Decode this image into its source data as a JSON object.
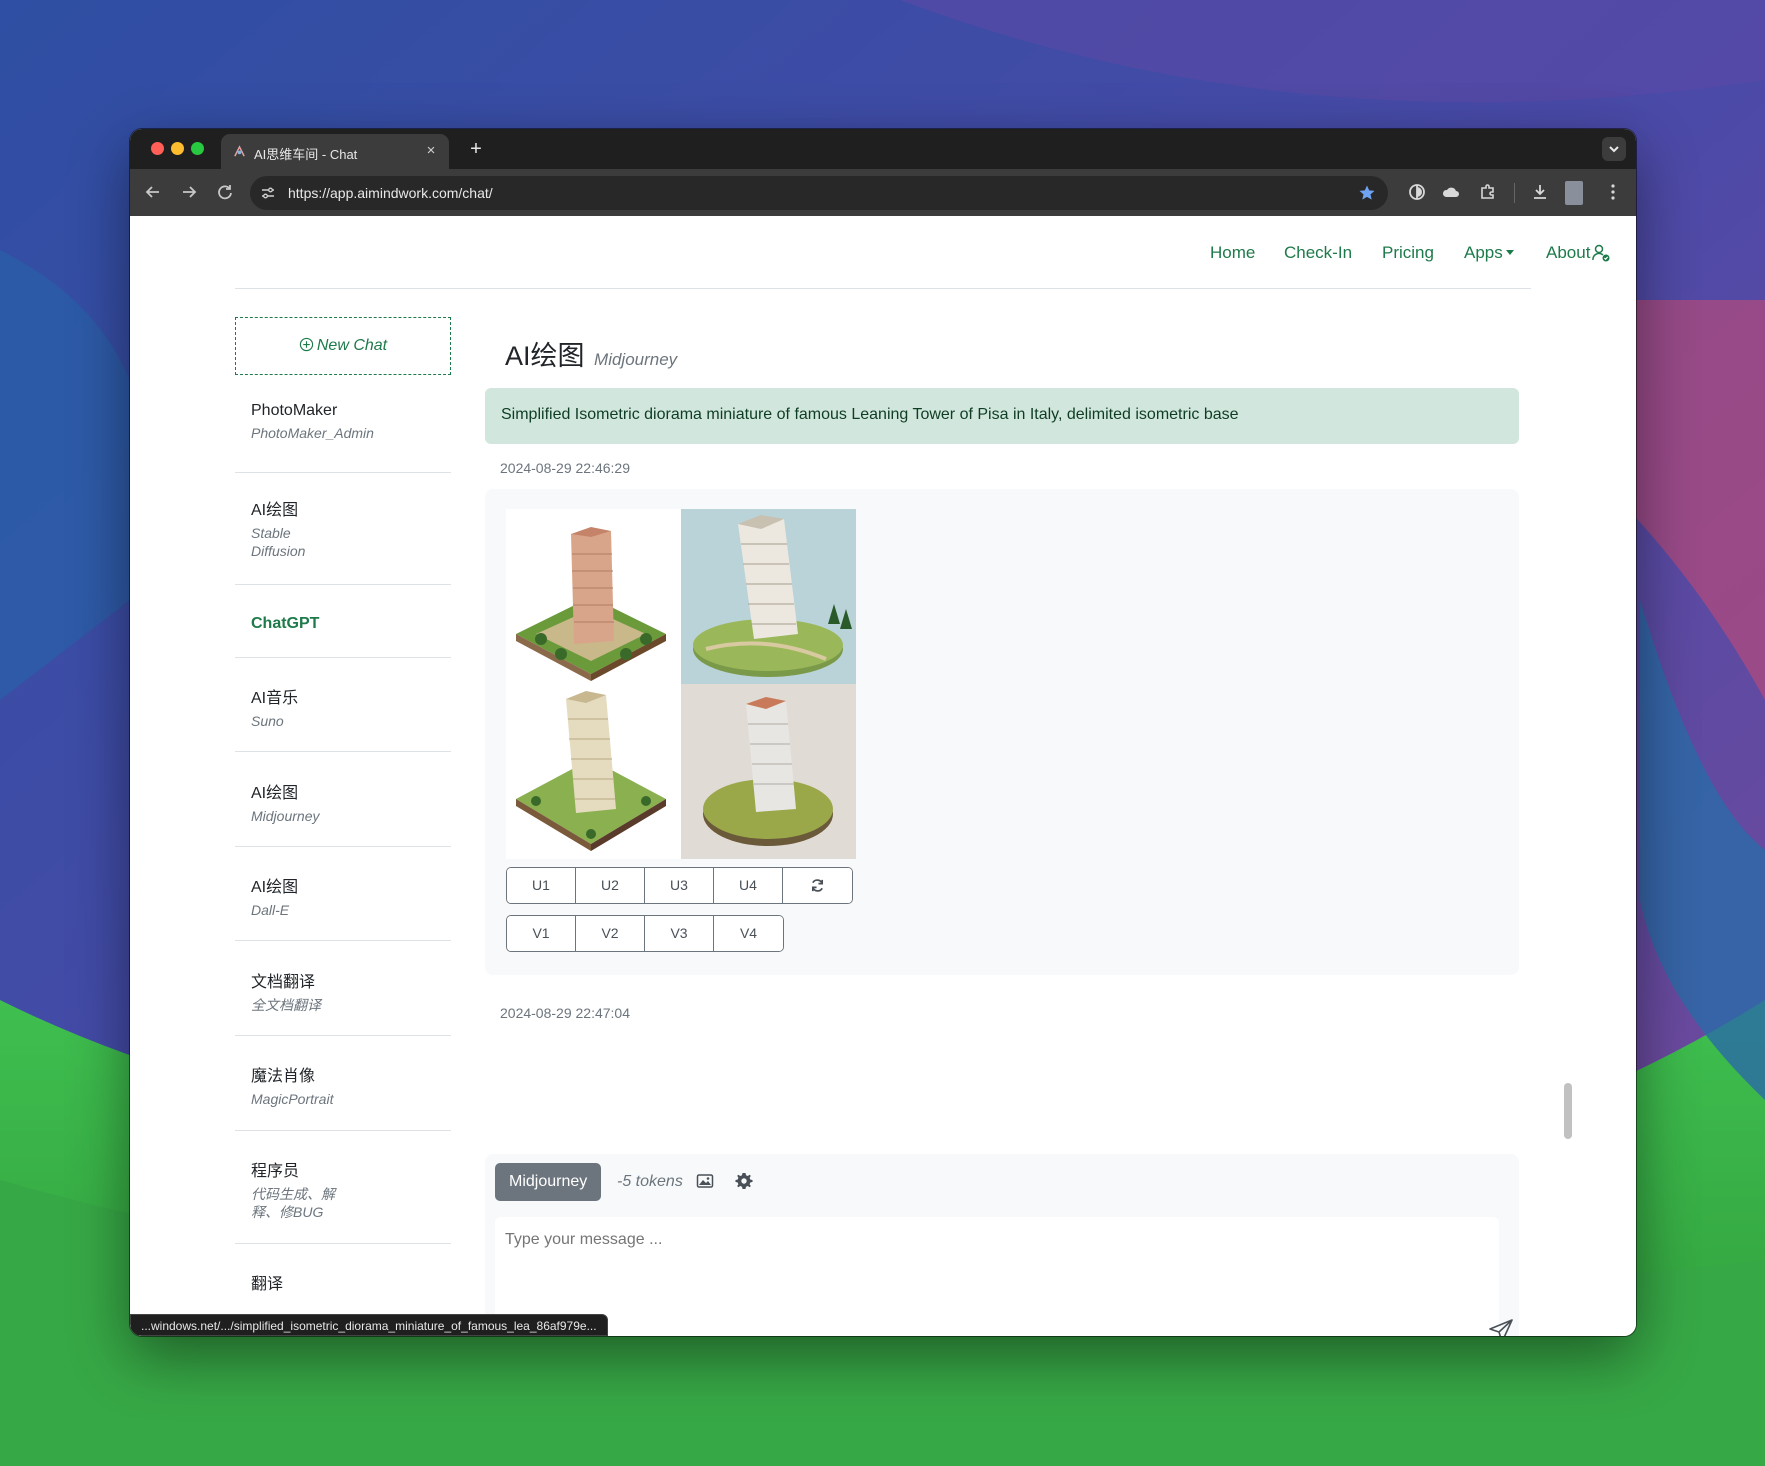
{
  "browser": {
    "tab_title": "AI思维车间 - Chat",
    "tab_close": "×",
    "new_tab": "+",
    "url": "https://app.aimindwork.com/chat/",
    "status_url": "...windows.net/.../simplified_isometric_diorama_miniature_of_famous_lea_86af979e..."
  },
  "nav": {
    "home": "Home",
    "checkin": "Check-In",
    "pricing": "Pricing",
    "apps": "Apps",
    "about": "About"
  },
  "sidebar": {
    "new_chat": "New Chat",
    "items": [
      {
        "title": "PhotoMaker",
        "subtitle": "PhotoMaker_Admin"
      },
      {
        "title": "AI绘图",
        "subtitle": "Stable Diffusion"
      },
      {
        "title": "ChatGPT",
        "subtitle": ""
      },
      {
        "title": "AI音乐",
        "subtitle": "Suno"
      },
      {
        "title": "AI绘图",
        "subtitle": "Midjourney"
      },
      {
        "title": "AI绘图",
        "subtitle": "Dall-E"
      },
      {
        "title": "文档翻译",
        "subtitle": "全文档翻译"
      },
      {
        "title": "魔法肖像",
        "subtitle": "MagicPortrait"
      },
      {
        "title": "程序员",
        "subtitle": "代码生成、解释、修BUG"
      },
      {
        "title": "翻译",
        "subtitle": ""
      }
    ]
  },
  "main": {
    "title": "AI绘图",
    "subtitle": "Midjourney",
    "user_message": "Simplified Isometric diorama miniature of famous Leaning Tower of Pisa in Italy, delimited isometric base",
    "user_timestamp": "2024-08-29 22:46:29",
    "bot_timestamp": "2024-08-29 22:47:04",
    "upscale_buttons": [
      "U1",
      "U2",
      "U3",
      "U4"
    ],
    "variation_buttons": [
      "V1",
      "V2",
      "V3",
      "V4"
    ]
  },
  "composer": {
    "model": "Midjourney",
    "tokens": "-5 tokens",
    "placeholder": "Type your message ..."
  },
  "colors": {
    "accent": "#1e7a4a",
    "user_bubble": "#d1e7dd",
    "model_button": "#6c757d"
  }
}
